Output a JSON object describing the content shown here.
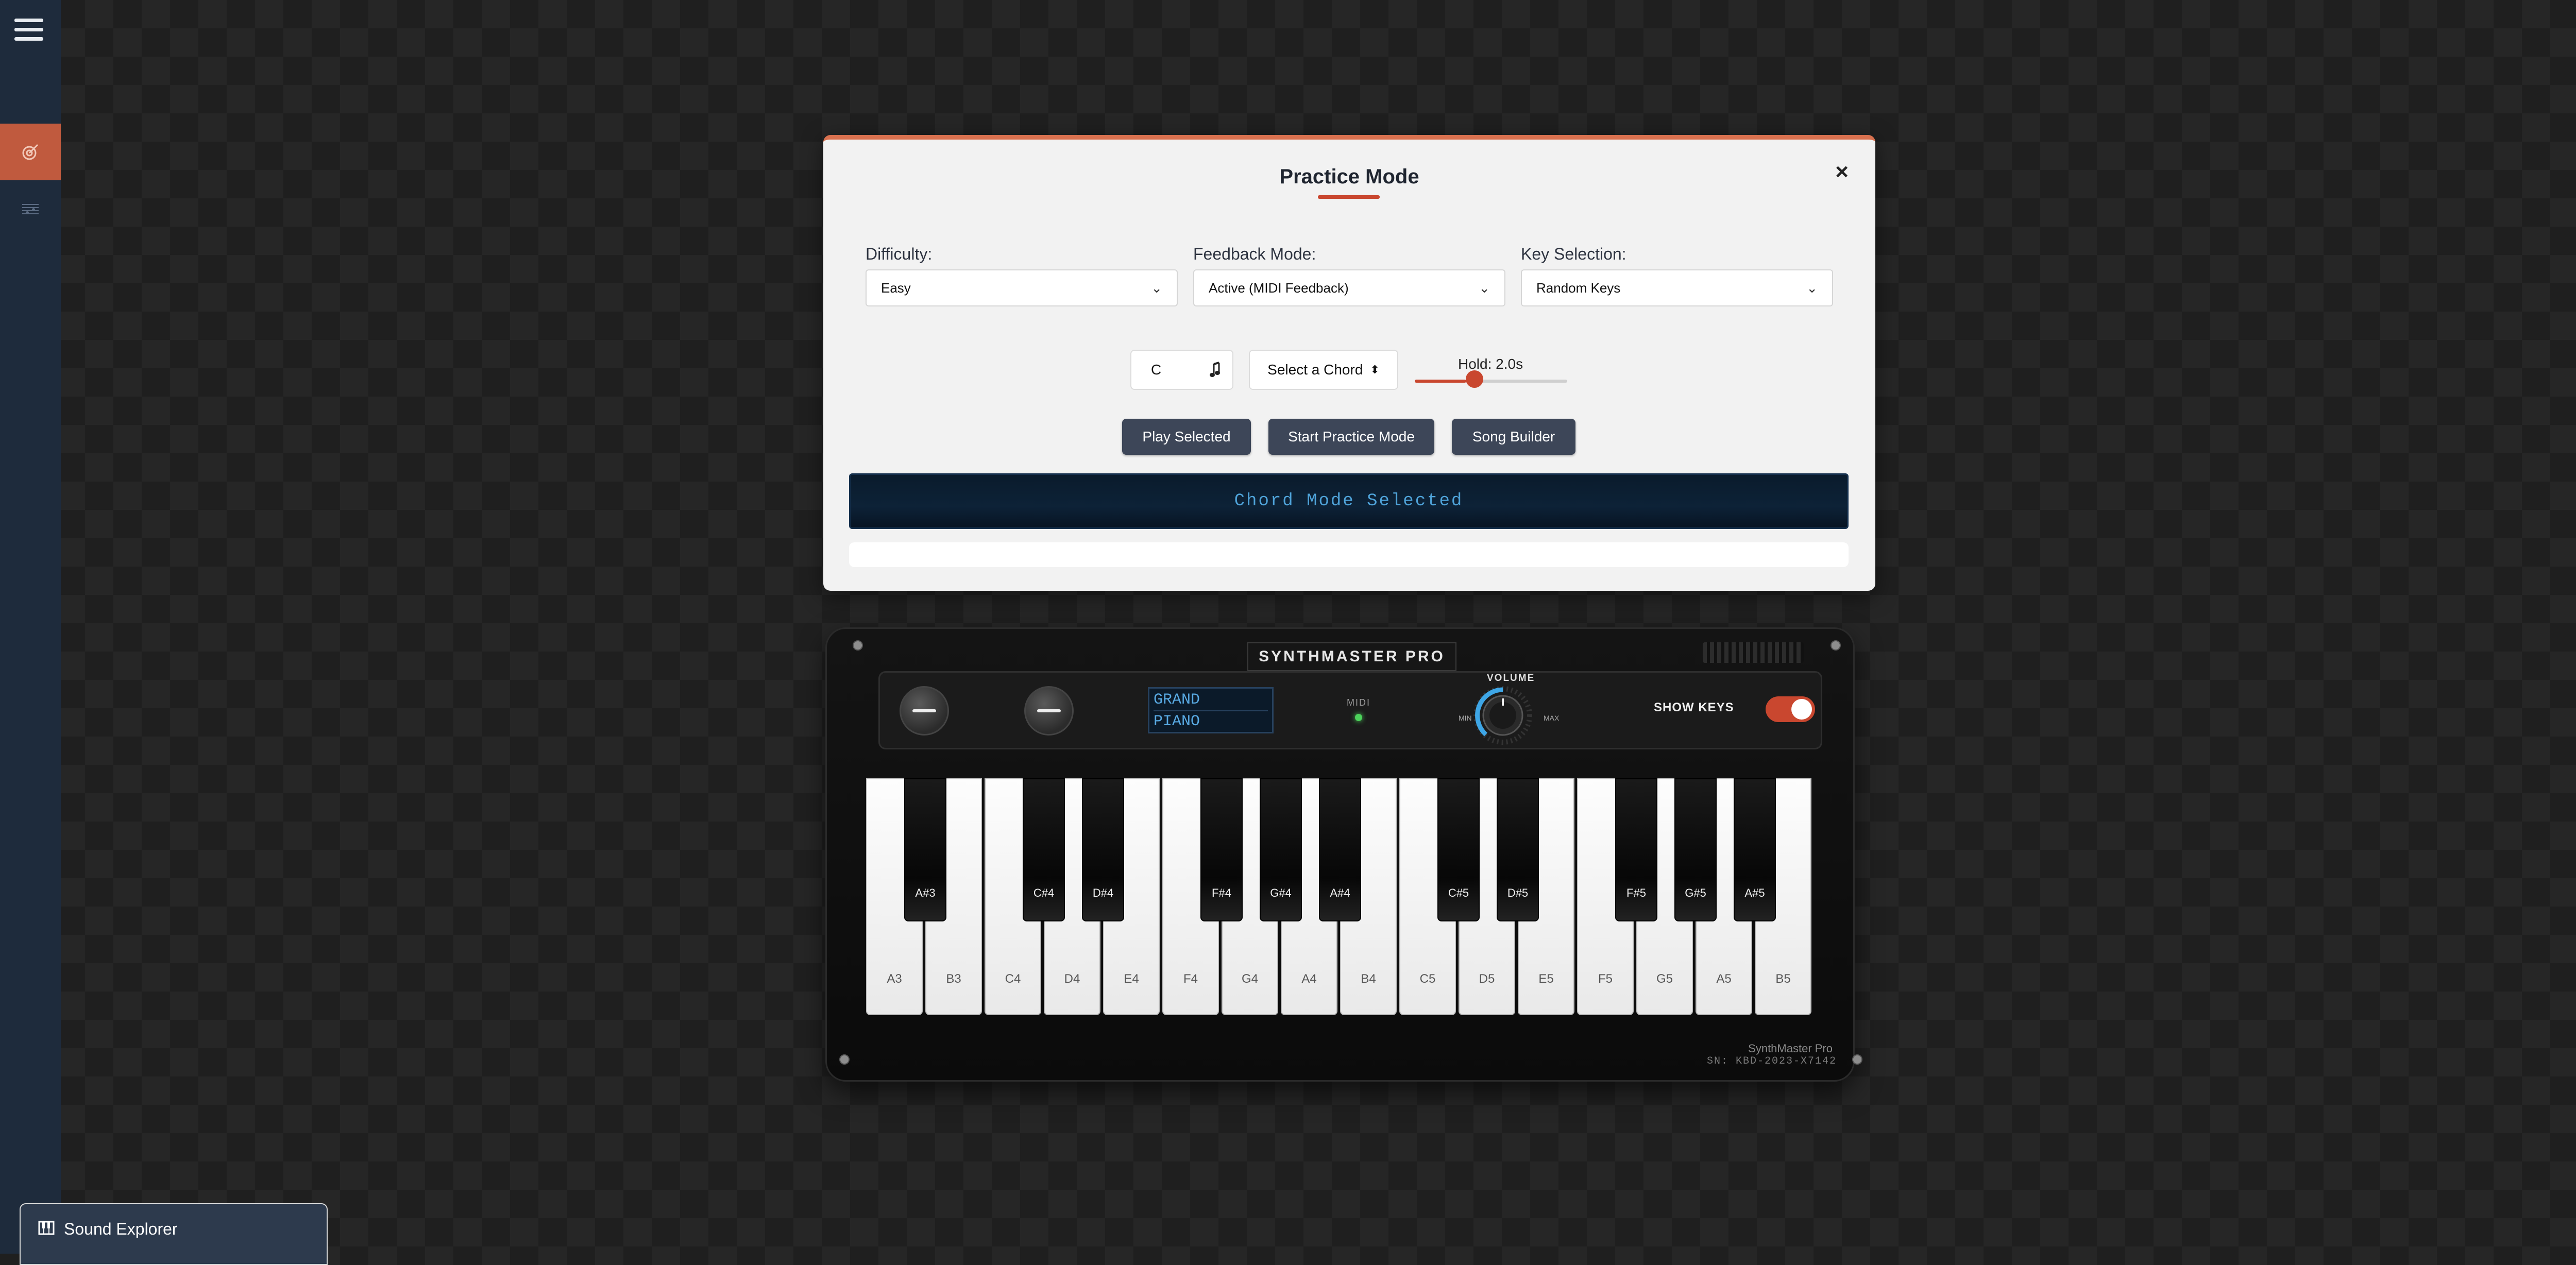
{
  "sidebar": {
    "menu_icon": "hamburger-icon",
    "items": [
      {
        "icon": "target-icon",
        "active": true
      },
      {
        "icon": "sheet-music-icon",
        "active": false
      }
    ]
  },
  "practice_modal": {
    "title": "Practice Mode",
    "close_label": "×",
    "difficulty": {
      "label": "Difficulty:",
      "value": "Easy"
    },
    "feedback_mode": {
      "label": "Feedback Mode:",
      "value": "Active (MIDI Feedback)"
    },
    "key_selection": {
      "label": "Key Selection:",
      "value": "Random Keys"
    },
    "root_note": {
      "value": "C",
      "icon": "music-note-icon"
    },
    "chord_select": {
      "value": "Select a Chord"
    },
    "hold": {
      "label": "Hold: 2.0s",
      "fraction": 0.35
    },
    "buttons": {
      "play_selected": "Play Selected",
      "start_practice": "Start Practice Mode",
      "song_builder": "Song Builder"
    },
    "status_display": "Chord Mode Selected"
  },
  "keyboard": {
    "brand": "SYNTHMASTER PRO",
    "lcd_line1": "GRAND",
    "lcd_line2": "PIANO",
    "midi_label": "MIDI",
    "volume_label": "VOLUME",
    "volume_min": "MIN",
    "volume_max": "MAX",
    "show_keys_label": "SHOW KEYS",
    "show_keys_on": true,
    "model_text": "SynthMaster Pro",
    "serial": "SN: KBD-2023-X7142",
    "colors": {
      "accent": "#c9472f",
      "led": "#4cd35b",
      "lcd_text": "#58a9e2"
    },
    "white_keys": [
      "A3",
      "B3",
      "C4",
      "D4",
      "E4",
      "F4",
      "G4",
      "A4",
      "B4",
      "C5",
      "D5",
      "E5",
      "F5",
      "G5",
      "A5",
      "B5"
    ],
    "black_keys": [
      "A#3",
      "C#4",
      "D#4",
      "F#4",
      "G#4",
      "A#4",
      "C#5",
      "D#5",
      "F#5",
      "G#5",
      "A#5"
    ]
  },
  "sound_explorer": {
    "label": "Sound Explorer",
    "icon": "piano-icon"
  }
}
